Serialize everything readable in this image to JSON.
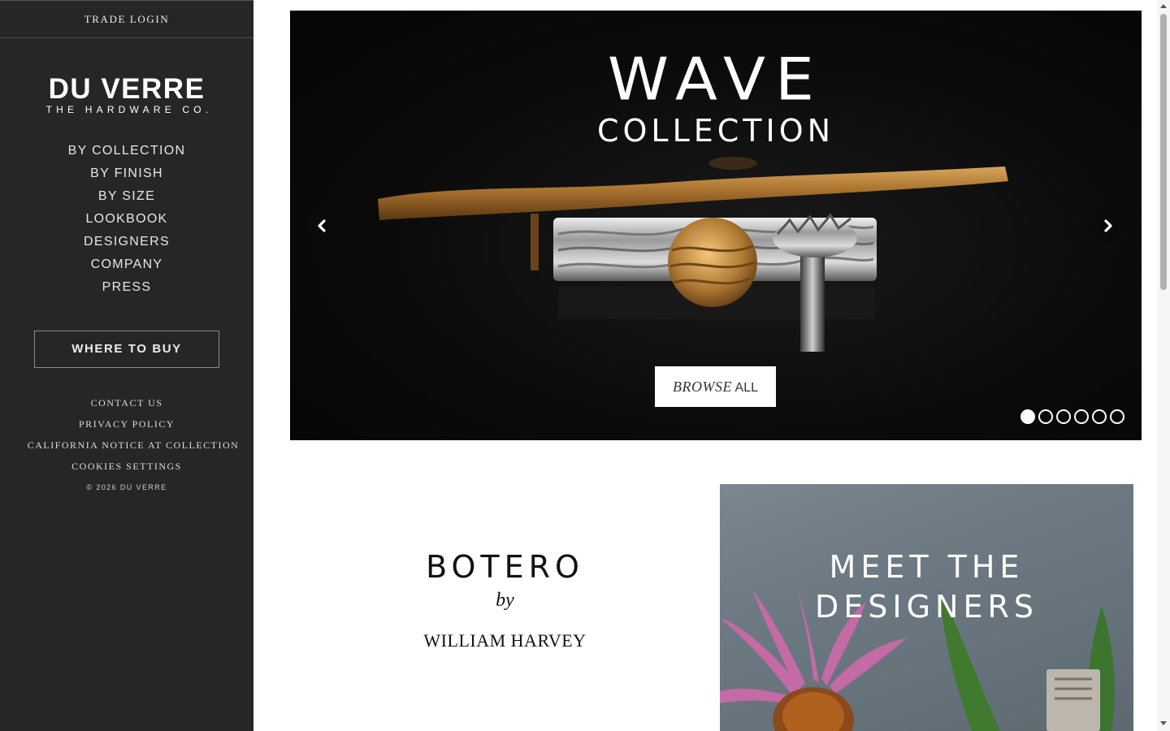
{
  "sidebar": {
    "trade_login": "TRADE LOGIN",
    "logo": {
      "main": "DU VERRE",
      "sub": "THE HARDWARE CO."
    },
    "nav": [
      {
        "label": "BY COLLECTION"
      },
      {
        "label": "BY FINISH"
      },
      {
        "label": "BY SIZE"
      },
      {
        "label": "LOOKBOOK"
      },
      {
        "label": "DESIGNERS"
      },
      {
        "label": "COMPANY"
      },
      {
        "label": "PRESS"
      }
    ],
    "where_to_buy": "WHERE TO BUY",
    "footer_links": [
      {
        "label": "CONTACT US"
      },
      {
        "label": "PRIVACY POLICY"
      },
      {
        "label": "CALIFORNIA NOTICE AT COLLECTION"
      },
      {
        "label": "COOKIES SETTINGS"
      }
    ],
    "copyright": "© 2026 DU VERRE"
  },
  "hero": {
    "title_line1": "WAVE",
    "title_line2": "COLLECTION",
    "button_italic": "BROWSE",
    "button_regular": "ALL",
    "prev_icon": "chevron-left-icon",
    "next_icon": "chevron-right-icon",
    "slide_count": 6,
    "active_slide": 1
  },
  "promo_left": {
    "line1": "BOTERO",
    "line2": "by",
    "line3": "WILLIAM HARVEY"
  },
  "promo_right": {
    "line1": "MEET THE",
    "line2": "DESIGNERS"
  },
  "colors": {
    "sidebar_bg": "#262626",
    "hero_bg": "#0b0b0b",
    "accent_white": "#ffffff",
    "designers_bg": "#6e7a83"
  }
}
